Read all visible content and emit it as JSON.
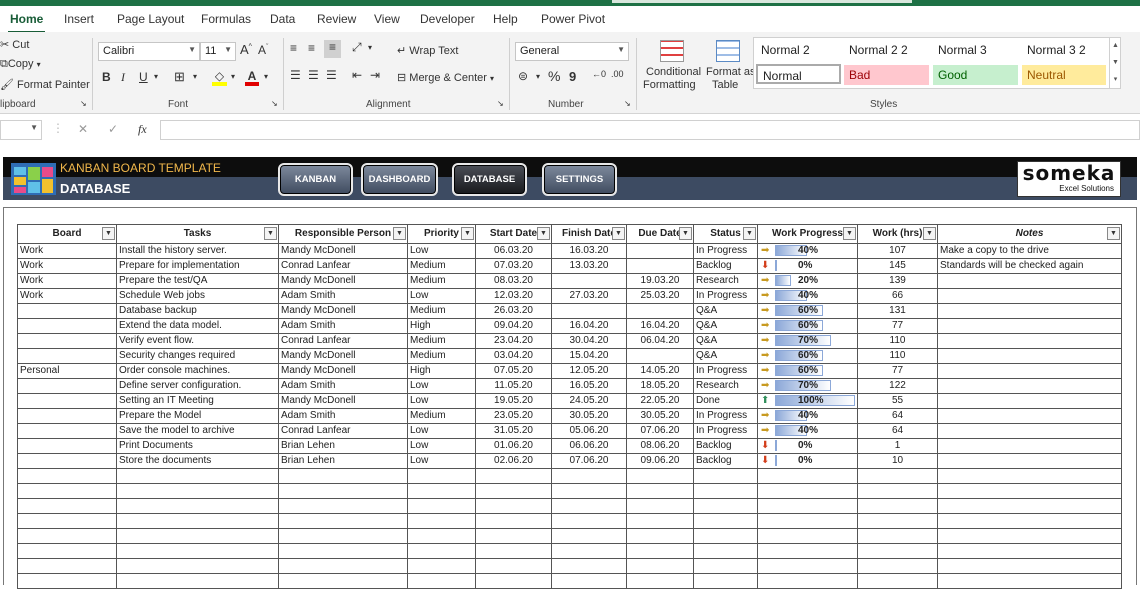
{
  "ribbon_tabs": [
    "Home",
    "Insert",
    "Page Layout",
    "Formulas",
    "Data",
    "Review",
    "View",
    "Developer",
    "Help",
    "Power Pivot"
  ],
  "clipboard": {
    "cut": "Cut",
    "copy": "Copy",
    "format_painter": "Format Painter",
    "label": "lipboard"
  },
  "font": {
    "name": "Calibri",
    "size": "11",
    "bold": "B",
    "italic": "I",
    "underline": "U",
    "grow": "A",
    "shrink": "A",
    "label": "Font"
  },
  "alignment": {
    "wrap": "Wrap Text",
    "merge": "Merge & Center",
    "label": "Alignment"
  },
  "number": {
    "format": "General",
    "percent": "%",
    "comma": "9",
    "label": "Number"
  },
  "styles": {
    "cond1": "Conditional",
    "cond2": "Formatting",
    "fmt1": "Format as",
    "fmt2": "Table",
    "label": "Styles",
    "cells": [
      {
        "name": "Normal 2",
        "bg": "#ffffff"
      },
      {
        "name": "Normal 2 2",
        "bg": "#ffffff"
      },
      {
        "name": "Normal 3",
        "bg": "#ffffff"
      },
      {
        "name": "Normal 3 2",
        "bg": "#ffffff"
      },
      {
        "name": "Normal",
        "bg": "#ffffff"
      },
      {
        "name": "Bad",
        "bg": "#ffc7ce",
        "color": "#9c0006"
      },
      {
        "name": "Good",
        "bg": "#c6efce",
        "color": "#006100"
      },
      {
        "name": "Neutral",
        "bg": "#ffeb9c",
        "color": "#9c5700"
      }
    ]
  },
  "formula_bar": {
    "fx": "fx",
    "cancel": "✕",
    "enter": "✓"
  },
  "header": {
    "kanban_template": "KANBAN BOARD TEMPLATE",
    "title": "DATABASE",
    "brand": "someka",
    "brand_sub": "Excel Solutions"
  },
  "nav": [
    "KANBAN",
    "DASHBOARD",
    "DATABASE",
    "SETTINGS"
  ],
  "columns": [
    "Board",
    "Tasks",
    "Responsible Person",
    "Priority",
    "Start Date",
    "Finish Date",
    "Due Date",
    "Status",
    "Work Progress",
    "Work (hrs)",
    "Notes"
  ],
  "rows": [
    {
      "board": "Work",
      "task": "Install the history server.",
      "person": "Mandy McDonell",
      "priority": "Low",
      "start": "06.03.20",
      "finish": "16.03.20",
      "due": "",
      "status": "In Progress",
      "progress": 40,
      "pct": "40%",
      "hrs": "107",
      "notes": "Make a copy to the drive"
    },
    {
      "board": "Work",
      "task": "Prepare for implementation",
      "person": "Conrad Lanfear",
      "priority": "Medium",
      "start": "07.03.20",
      "finish": "13.03.20",
      "due": "",
      "status": "Backlog",
      "progress": 0,
      "pct": "0%",
      "hrs": "145",
      "notes": "Standards will be checked again"
    },
    {
      "board": "Work",
      "task": "Prepare the test/QA",
      "person": "Mandy McDonell",
      "priority": "Medium",
      "start": "08.03.20",
      "finish": "",
      "due": "19.03.20",
      "status": "Research",
      "progress": 20,
      "pct": "20%",
      "hrs": "139",
      "notes": ""
    },
    {
      "board": "Work",
      "task": "Schedule Web jobs",
      "person": "Adam Smith",
      "priority": "Low",
      "start": "12.03.20",
      "finish": "27.03.20",
      "due": "25.03.20",
      "status": "In Progress",
      "progress": 40,
      "pct": "40%",
      "hrs": "66",
      "notes": ""
    },
    {
      "board": "",
      "task": "Database backup",
      "person": "Mandy McDonell",
      "priority": "Medium",
      "start": "26.03.20",
      "finish": "",
      "due": "",
      "status": "Q&A",
      "progress": 60,
      "pct": "60%",
      "hrs": "131",
      "notes": ""
    },
    {
      "board": "",
      "task": "Extend the data model.",
      "person": "Adam Smith",
      "priority": "High",
      "start": "09.04.20",
      "finish": "16.04.20",
      "due": "16.04.20",
      "status": "Q&A",
      "progress": 60,
      "pct": "60%",
      "hrs": "77",
      "notes": ""
    },
    {
      "board": "",
      "task": "Verify event flow.",
      "person": "Conrad Lanfear",
      "priority": "Medium",
      "start": "23.04.20",
      "finish": "30.04.20",
      "due": "06.04.20",
      "status": "Q&A",
      "progress": 70,
      "pct": "70%",
      "hrs": "110",
      "notes": ""
    },
    {
      "board": "",
      "task": "Security changes required",
      "person": "Mandy McDonell",
      "priority": "Medium",
      "start": "03.04.20",
      "finish": "15.04.20",
      "due": "",
      "status": "Q&A",
      "progress": 60,
      "pct": "60%",
      "hrs": "110",
      "notes": ""
    },
    {
      "board": "Personal",
      "task": "Order console machines.",
      "person": "Mandy McDonell",
      "priority": "High",
      "start": "07.05.20",
      "finish": "12.05.20",
      "due": "14.05.20",
      "status": "In Progress",
      "progress": 60,
      "pct": "60%",
      "hrs": "77",
      "notes": ""
    },
    {
      "board": "",
      "task": "Define server configuration.",
      "person": "Adam Smith",
      "priority": "Low",
      "start": "11.05.20",
      "finish": "16.05.20",
      "due": "18.05.20",
      "status": "Research",
      "progress": 70,
      "pct": "70%",
      "hrs": "122",
      "notes": ""
    },
    {
      "board": "",
      "task": "Setting an IT Meeting",
      "person": "Mandy McDonell",
      "priority": "Low",
      "start": "19.05.20",
      "finish": "24.05.20",
      "due": "22.05.20",
      "status": "Done",
      "progress": 100,
      "pct": "100%",
      "hrs": "55",
      "notes": ""
    },
    {
      "board": "",
      "task": "Prepare the Model",
      "person": "Adam Smith",
      "priority": "Medium",
      "start": "23.05.20",
      "finish": "30.05.20",
      "due": "30.05.20",
      "status": "In Progress",
      "progress": 40,
      "pct": "40%",
      "hrs": "64",
      "notes": ""
    },
    {
      "board": "",
      "task": "Save the model to archive",
      "person": "Conrad Lanfear",
      "priority": "Low",
      "start": "31.05.20",
      "finish": "05.06.20",
      "due": "07.06.20",
      "status": "In Progress",
      "progress": 40,
      "pct": "40%",
      "hrs": "64",
      "notes": ""
    },
    {
      "board": "",
      "task": "Print Documents",
      "person": "Brian Lehen",
      "priority": "Low",
      "start": "01.06.20",
      "finish": "06.06.20",
      "due": "08.06.20",
      "status": "Backlog",
      "progress": 0,
      "pct": "0%",
      "hrs": "1",
      "notes": ""
    },
    {
      "board": "",
      "task": "Store the documents",
      "person": "Brian Lehen",
      "priority": "Low",
      "start": "02.06.20",
      "finish": "07.06.20",
      "due": "09.06.20",
      "status": "Backlog",
      "progress": 0,
      "pct": "0%",
      "hrs": "10",
      "notes": ""
    }
  ],
  "empty_rows": 8
}
